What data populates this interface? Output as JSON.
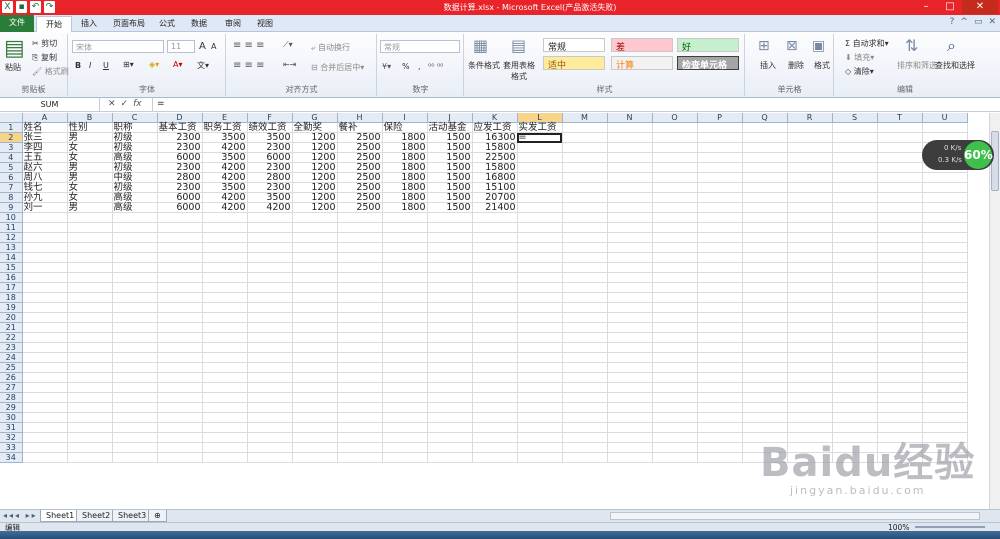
{
  "window": {
    "title": "数据计算.xlsx - Microsoft Excel(产品激活失败)",
    "qat_icons": [
      "excel-icon",
      "save-icon",
      "undo-icon",
      "redo-icon"
    ]
  },
  "tabs": [
    "文件",
    "开始",
    "插入",
    "页面布局",
    "公式",
    "数据",
    "审阅",
    "视图"
  ],
  "active_tab": "开始",
  "ribbon": {
    "clipboard": {
      "label": "剪贴板",
      "paste": "粘贴",
      "cut": "剪切",
      "copy": "复制",
      "format_painter": "格式刷"
    },
    "font": {
      "label": "字体",
      "font_name": "宋体",
      "font_size": "11",
      "bold": "B",
      "italic": "I",
      "underline": "U",
      "grow": "A",
      "shrink": "A"
    },
    "alignment": {
      "label": "对齐方式",
      "wrap": "自动换行",
      "merge": "合并后居中"
    },
    "number": {
      "label": "数字",
      "format": "常规",
      "percent": "%",
      "comma": ","
    },
    "styles": {
      "label": "样式",
      "conditional": "条件格式",
      "table": "套用表格格式",
      "cells": [
        {
          "text": "常规",
          "color": "#222222",
          "bg": "#ffffff"
        },
        {
          "text": "差",
          "color": "#9c0006",
          "bg": "#ffc7ce"
        },
        {
          "text": "好",
          "color": "#006100",
          "bg": "#c6efce"
        },
        {
          "text": "适中",
          "color": "#9c5700",
          "bg": "#ffeb9c"
        },
        {
          "text": "计算",
          "color": "#fa7d00",
          "bg": "#f2f2f2"
        },
        {
          "text": "检查单元格",
          "color": "#ffffff",
          "bg": "#a5a5a5"
        }
      ]
    },
    "cells": {
      "label": "单元格",
      "insert": "插入",
      "delete": "删除",
      "format": "格式"
    },
    "editing": {
      "label": "编辑",
      "autosum": "自动求和",
      "fill": "填充",
      "clear": "清除",
      "sort": "排序和筛选",
      "find": "查找和选择"
    }
  },
  "formula_bar": {
    "name_box": "SUM",
    "content": "="
  },
  "columns": [
    "A",
    "B",
    "C",
    "D",
    "E",
    "F",
    "G",
    "H",
    "I",
    "J",
    "K",
    "L",
    "M",
    "N",
    "O",
    "P",
    "Q",
    "R",
    "S",
    "T",
    "U"
  ],
  "selected_column": "L",
  "selected_row": 2,
  "rows": [
    [
      "姓名",
      "性别",
      "职称",
      "基本工资",
      "职务工资",
      "绩效工资",
      "全勤奖",
      "餐补",
      "保险",
      "活动基金",
      "应发工资",
      "实发工资"
    ],
    [
      "张三",
      "男",
      "初级",
      "2300",
      "3500",
      "3500",
      "1200",
      "2500",
      "1800",
      "1500",
      "16300",
      "="
    ],
    [
      "李四",
      "女",
      "初级",
      "2300",
      "4200",
      "2300",
      "1200",
      "2500",
      "1800",
      "1500",
      "15800",
      ""
    ],
    [
      "王五",
      "女",
      "高级",
      "6000",
      "3500",
      "6000",
      "1200",
      "2500",
      "1800",
      "1500",
      "22500",
      ""
    ],
    [
      "赵六",
      "男",
      "初级",
      "2300",
      "4200",
      "2300",
      "1200",
      "2500",
      "1800",
      "1500",
      "15800",
      ""
    ],
    [
      "周八",
      "男",
      "中级",
      "2800",
      "4200",
      "2800",
      "1200",
      "2500",
      "1800",
      "1500",
      "16800",
      ""
    ],
    [
      "钱七",
      "女",
      "初级",
      "2300",
      "3500",
      "2300",
      "1200",
      "2500",
      "1800",
      "1500",
      "15100",
      ""
    ],
    [
      "孙九",
      "女",
      "高级",
      "6000",
      "4200",
      "3500",
      "1200",
      "2500",
      "1800",
      "1500",
      "20700",
      ""
    ],
    [
      "刘一",
      "男",
      "高级",
      "6000",
      "4200",
      "4200",
      "1200",
      "2500",
      "1800",
      "1500",
      "21400",
      ""
    ]
  ],
  "total_rows": 34,
  "sheets": [
    "Sheet1",
    "Sheet2",
    "Sheet3"
  ],
  "active_sheet": "Sheet1",
  "status": {
    "mode": "编辑",
    "zoom": "100%"
  },
  "speed_widget": {
    "up": "0 K/s",
    "down": "0.3 K/s",
    "percent": "60%"
  },
  "watermark": {
    "brand": "Baidu经验",
    "url": "jingyan.baidu.com"
  }
}
